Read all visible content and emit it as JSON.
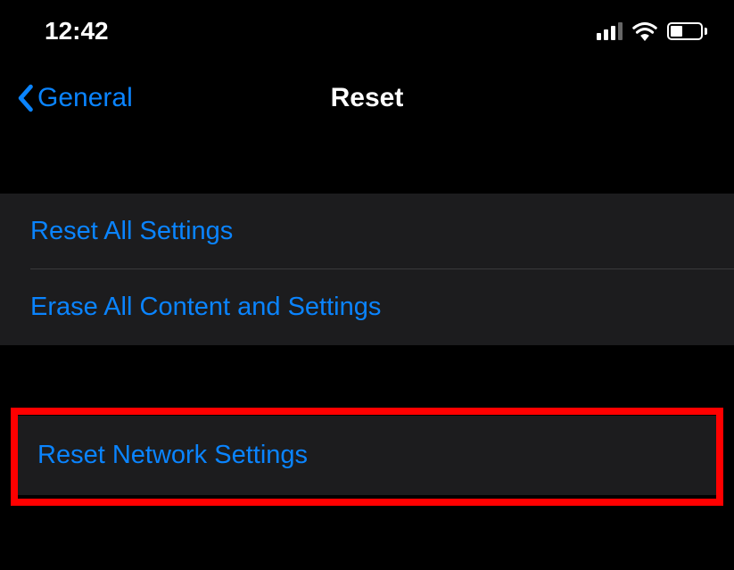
{
  "status": {
    "time": "12:42"
  },
  "nav": {
    "back_label": "General",
    "title": "Reset"
  },
  "group1": {
    "item1": "Reset All Settings",
    "item2": "Erase All Content and Settings"
  },
  "group2": {
    "item1": "Reset Network Settings"
  }
}
